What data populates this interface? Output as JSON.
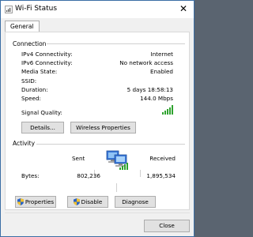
{
  "window": {
    "title": "Wi-Fi Status",
    "close_glyph": "✕"
  },
  "tabs": [
    {
      "label": "General"
    }
  ],
  "connection": {
    "header": "Connection",
    "rows": [
      {
        "label": "IPv4 Connectivity:",
        "value": "Internet"
      },
      {
        "label": "IPv6 Connectivity:",
        "value": "No network access"
      },
      {
        "label": "Media State:",
        "value": "Enabled"
      },
      {
        "label": "SSID:",
        "value": ""
      },
      {
        "label": "Duration:",
        "value": "5 days 18:58:13"
      },
      {
        "label": "Speed:",
        "value": "144.0 Mbps"
      }
    ],
    "signal_label": "Signal Quality:",
    "signal_bars": 5,
    "details_button": "Details...",
    "wireless_button": "Wireless Properties"
  },
  "activity": {
    "header": "Activity",
    "sent_label": "Sent",
    "received_label": "Received",
    "bytes_label": "Bytes:",
    "bytes_sent": "802,236",
    "bytes_received": "1,895,534"
  },
  "buttons": {
    "properties": "Properties",
    "disable": "Disable",
    "diagnose": "Diagnose",
    "close": "Close"
  },
  "colors": {
    "signal_green": "#2fa32f",
    "shield_blue": "#2a64c5",
    "shield_yellow": "#f2c12e"
  },
  "icons": {
    "title": "wifi-icon",
    "network": "network-computers-icon",
    "shield": "uac-shield-icon"
  }
}
